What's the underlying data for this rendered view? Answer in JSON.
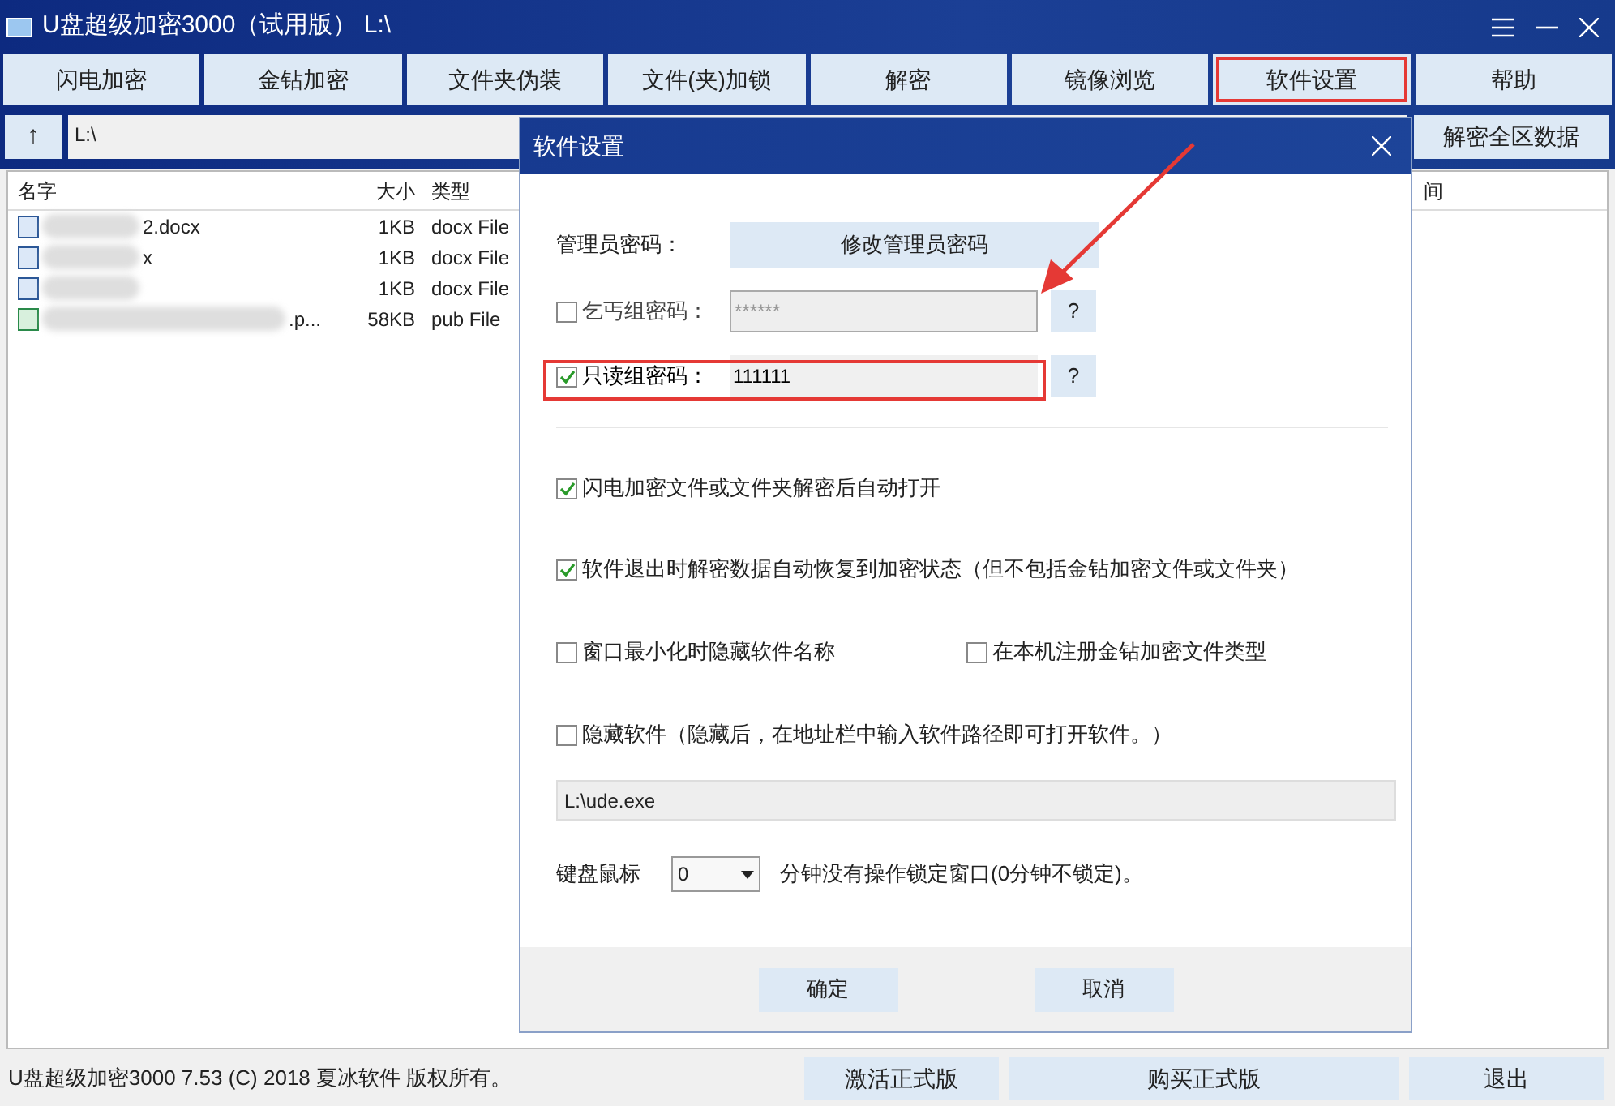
{
  "window": {
    "title": "U盘超级加密3000（试用版） L:\\"
  },
  "toolbar": [
    {
      "label": "闪电加密",
      "selected": false
    },
    {
      "label": "金钻加密",
      "selected": false
    },
    {
      "label": "文件夹伪装",
      "selected": false
    },
    {
      "label": "文件(夹)加锁",
      "selected": false
    },
    {
      "label": "解密",
      "selected": false
    },
    {
      "label": "镜像浏览",
      "selected": false
    },
    {
      "label": "软件设置",
      "selected": true
    },
    {
      "label": "帮助",
      "selected": false
    }
  ],
  "address": {
    "up": "↑",
    "value": "L:\\",
    "decrypt_all": "解密全区数据"
  },
  "file_list": {
    "columns": [
      "名字",
      "大小",
      "类型",
      "间"
    ],
    "rows": [
      {
        "kind": "word",
        "name": "2.docx",
        "size": "1KB",
        "type": "docx File"
      },
      {
        "kind": "word",
        "name": "x",
        "size": "1KB",
        "type": "docx File"
      },
      {
        "kind": "word",
        "size": "1KB",
        "type": "docx File"
      },
      {
        "kind": "publisher",
        "name": ".p...",
        "size": "58KB",
        "type": "pub File"
      }
    ]
  },
  "dialog": {
    "title": "软件设置",
    "admin": {
      "label": "管理员密码：",
      "button": "修改管理员密码"
    },
    "passwords": [
      {
        "label": "乞丐组密码：",
        "checked": false,
        "placeholder": "******",
        "help": "?"
      },
      {
        "label": "只读组密码：",
        "checked": true,
        "value": "111111",
        "help": "?"
      }
    ],
    "options": [
      [
        {
          "label": "闪电加密文件或文件夹解密后自动打开",
          "checked": true
        }
      ],
      [
        {
          "label": "软件退出时解密数据自动恢复到加密状态（但不包括金钻加密文件或文件夹）",
          "checked": true
        }
      ],
      [
        {
          "label": "窗口最小化时隐藏软件名称",
          "checked": false
        },
        {
          "label": "在本机注册金钻加密文件类型",
          "checked": false
        }
      ],
      [
        {
          "label": "隐藏软件（隐藏后，在地址栏中输入软件路径即可打开软件。）",
          "checked": false
        }
      ]
    ],
    "path": "L:\\ude.exe",
    "lock": {
      "label": "键盘鼠标",
      "value": "0",
      "suffix": "分钟没有操作锁定窗口(0分钟不锁定)。"
    },
    "buttons": [
      "确定",
      "取消"
    ]
  },
  "status_bar": {
    "text": "U盘超级加密3000 7.53 (C) 2018 夏冰软件 版权所有。",
    "buttons": [
      "激活正式版",
      "购买正式版",
      "退出"
    ]
  }
}
